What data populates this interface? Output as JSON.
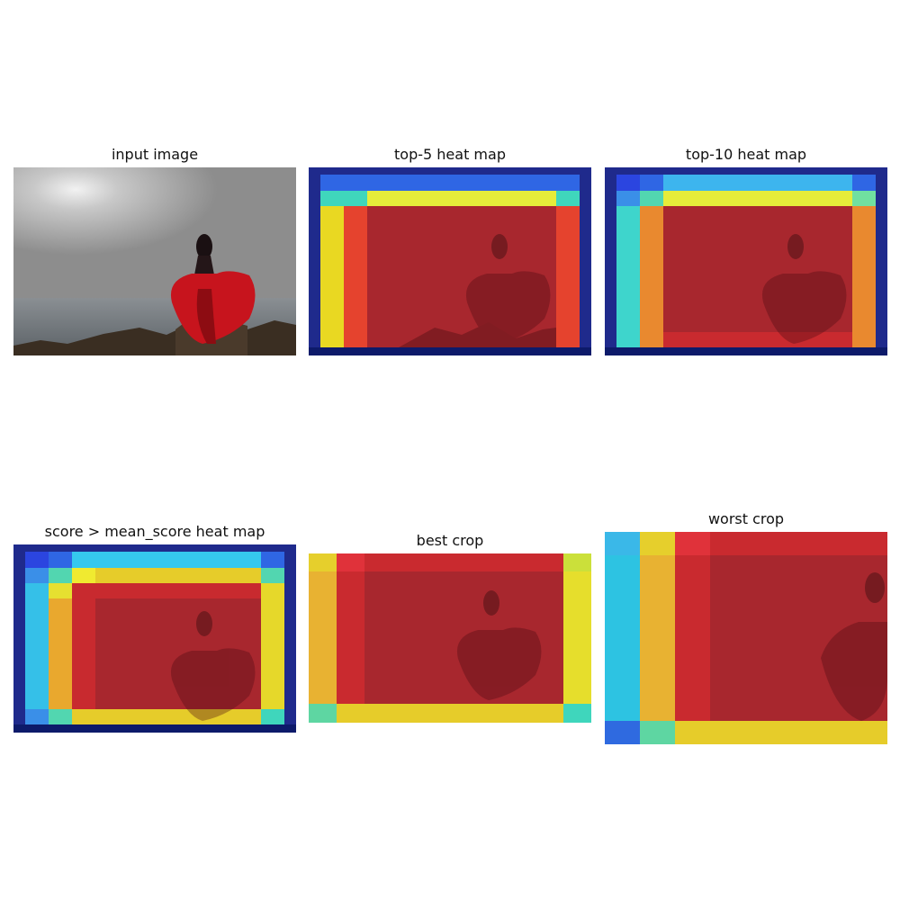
{
  "panels": [
    {
      "id": "input",
      "title": "input image",
      "kind": "photo"
    },
    {
      "id": "top5",
      "title": "top-5 heat map",
      "kind": "heat",
      "cols": [
        0.043,
        0.088,
        0.193,
        0.877,
        0.957
      ],
      "rows": [
        0.043,
        0.125,
        0.205,
        0.957
      ],
      "grid": [
        [
          "#3a63e6",
          "#3a63e6",
          "#3a63e6",
          "#3a63e6",
          "#3a63e6",
          "#3a63e6"
        ],
        [
          "#45d9c2",
          "#45d9c2",
          "#e8ef3a",
          "#e8ef3a",
          "#45d9c2",
          "#45d9c2"
        ],
        [
          "#e8d821",
          "#e8412b",
          "#b3262b",
          "#b3262b",
          "#e8412b",
          "#e8412b"
        ],
        [
          "#e8d821",
          "#e8412b",
          "#b3262b",
          "#b3262b",
          "#e8412b",
          "#e8412b"
        ]
      ]
    },
    {
      "id": "top10",
      "title": "top-10 heat map",
      "kind": "heat"
    },
    {
      "id": "mean",
      "title": "score > mean_score heat map",
      "kind": "heat"
    },
    {
      "id": "best",
      "title": "best crop",
      "kind": "heat"
    },
    {
      "id": "worst",
      "title": "worst crop",
      "kind": "heat"
    }
  ],
  "colors": {
    "navy": "#1f2a8c",
    "blue": "#2f5fe0",
    "light_blue": "#3db5ee",
    "cyan": "#2dc8e8",
    "teal": "#3fdcb8",
    "yellow": "#ece52a",
    "orange": "#eba832",
    "red": "#e0323a",
    "dark_red": "#a62730"
  }
}
